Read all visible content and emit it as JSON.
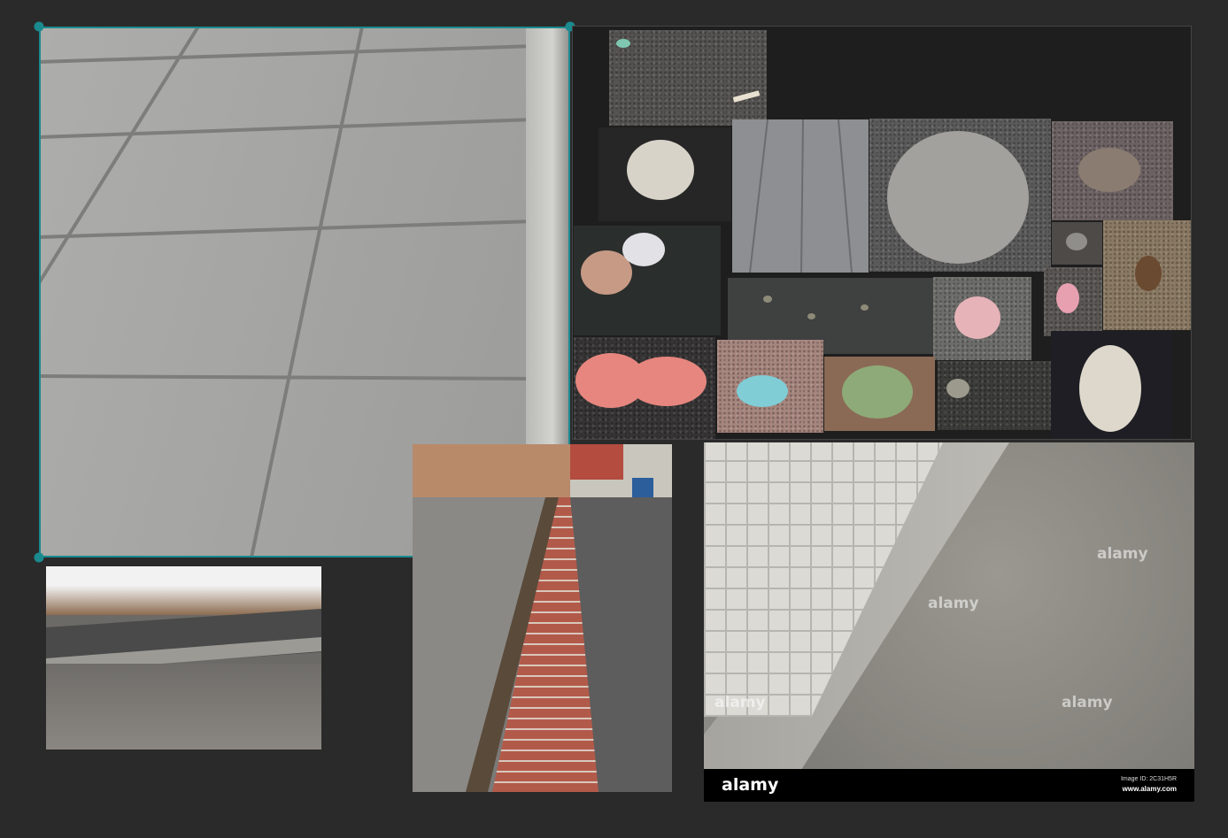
{
  "canvas": {
    "background": "#2a2a2a",
    "selection_color": "#1a8a8f"
  },
  "images": {
    "sidewalk": {
      "icon": "concrete-sidewalk-image"
    },
    "curb_snow": {
      "icon": "curb-with-snow-image"
    },
    "brick_gutter": {
      "icon": "brick-gutter-alley-image"
    },
    "gum_collage": {
      "icon": "chewing-gum-collage-image"
    },
    "stock_photo": {
      "icon": "tiled-curb-stock-image",
      "watermark": "alamy",
      "footer_brand": "alamy",
      "image_id": "Image ID: 2C31H5R",
      "site": "www.alamy.com"
    }
  }
}
